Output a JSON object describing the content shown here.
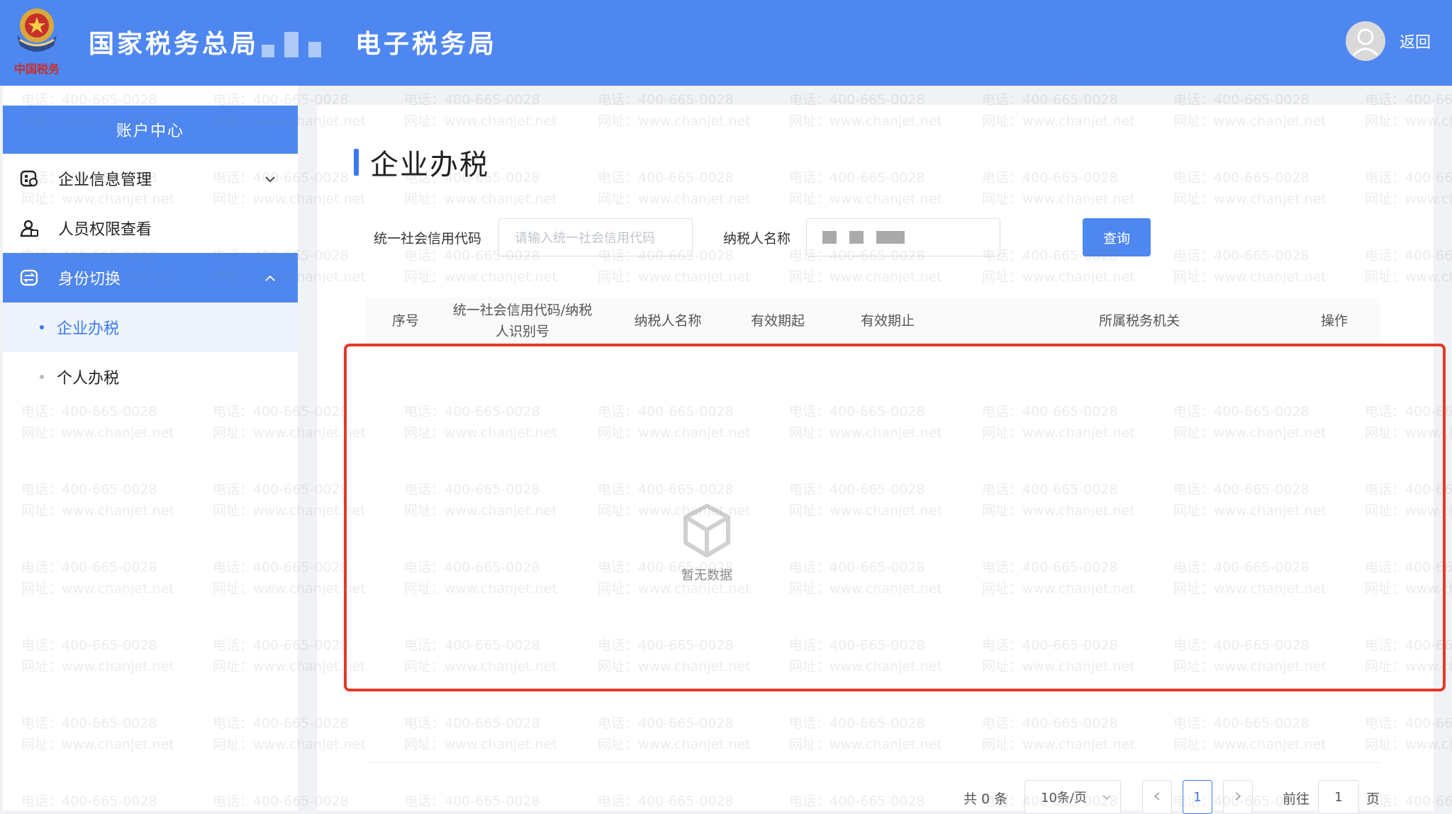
{
  "header": {
    "title_part1": "国家税务总局",
    "title_part2": "电子税务局",
    "back_label": "返回",
    "emblem_caption": "中国税务"
  },
  "sidebar": {
    "header": "账户中心",
    "menu": [
      {
        "label": "企业信息管理",
        "icon": "building-settings-icon"
      },
      {
        "label": "人员权限查看",
        "icon": "person-lock-icon"
      },
      {
        "label": "身份切换",
        "icon": "switch-icon"
      }
    ],
    "submenu": [
      {
        "label": "企业办税"
      },
      {
        "label": "个人办税"
      }
    ]
  },
  "main": {
    "title": "企业办税",
    "search": {
      "credit_code_label": "统一社会信用代码",
      "credit_code_placeholder": "请输入统一社会信用代码",
      "taxpayer_name_label": "纳税人名称",
      "query_button": "查询"
    },
    "table": {
      "headers": [
        "序号",
        "统一社会信用代码/纳税人识别号",
        "纳税人名称",
        "有效期起",
        "有效期止",
        "所属税务机关",
        "操作"
      ],
      "empty_text": "暂无数据"
    },
    "pagination": {
      "total": "共 0 条",
      "page_size": "10条/页",
      "current_page": "1",
      "goto_label": "前往",
      "goto_value": "1",
      "page_suffix": "页"
    }
  },
  "watermark": {
    "line1": "电话：400-665-0028",
    "line2": "网址：www.chanjet.net"
  },
  "colors": {
    "header_bg": "#4e87f0",
    "active_text": "#3a7af0",
    "highlight_border": "#e53928"
  }
}
